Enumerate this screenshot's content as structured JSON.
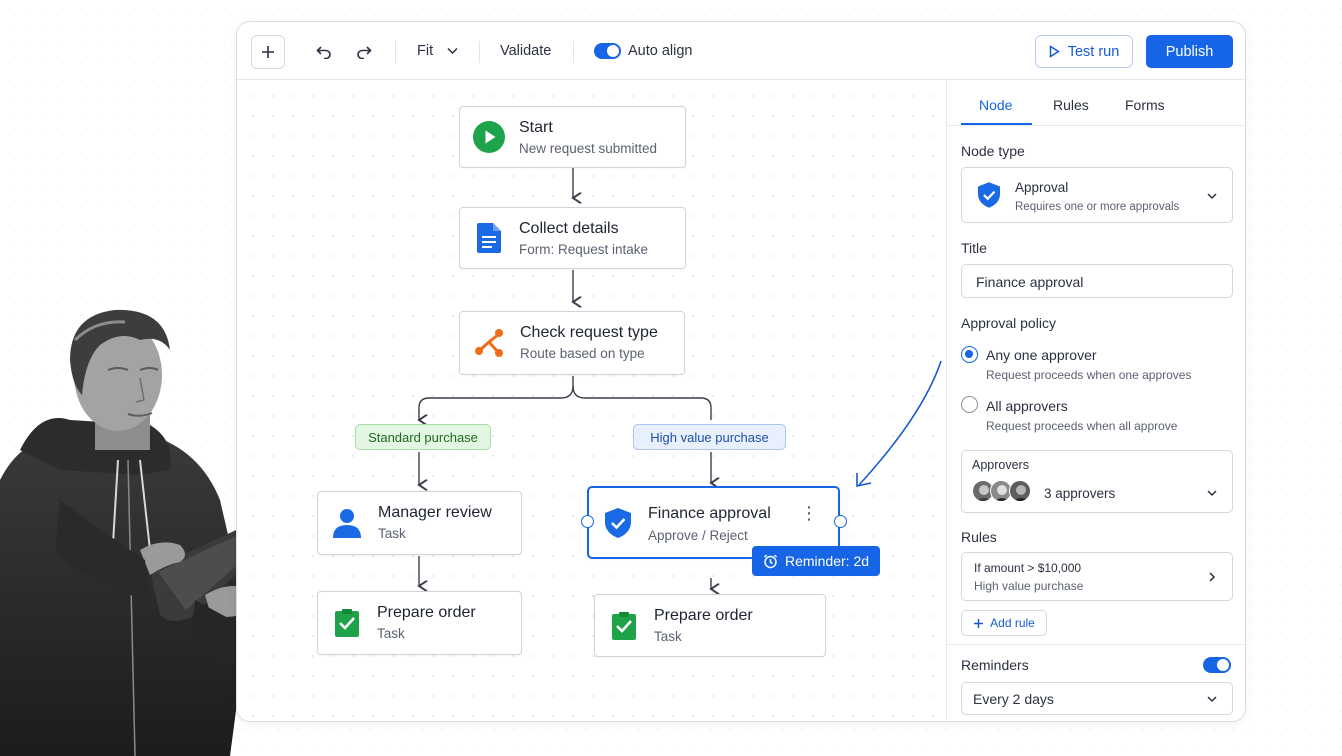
{
  "toolbar": {
    "zoom_label": "Fit",
    "validate_label": "Validate",
    "auto_align_label": "Auto align",
    "auto_align_on": true,
    "test_run_label": "Test run",
    "publish_label": "Publish"
  },
  "flow": {
    "start": {
      "title": "Start",
      "subtitle": "New request submitted",
      "icon": "play-circle-icon"
    },
    "collect": {
      "title": "Collect details",
      "subtitle": "Form: Request intake",
      "icon": "document-icon"
    },
    "check": {
      "title": "Check request type",
      "subtitle": "Route based on type",
      "icon": "branch-icon"
    },
    "branch_left": {
      "label": "Standard purchase"
    },
    "branch_right": {
      "label": "High value purchase"
    },
    "manager": {
      "title": "Manager review",
      "subtitle": "Task",
      "icon": "person-icon"
    },
    "finance": {
      "title": "Finance approval",
      "subtitle": "Approve / Reject",
      "icon": "shield-check-icon"
    },
    "reminder_badge": "Reminder: 2d",
    "prepare_left": {
      "title": "Prepare order",
      "subtitle": "Task",
      "icon": "checklist-icon"
    },
    "prepare_right": {
      "title": "Prepare order",
      "subtitle": "Task",
      "icon": "checklist-icon"
    }
  },
  "panel": {
    "tabs": [
      {
        "label": "Node",
        "active": true
      },
      {
        "label": "Rules",
        "active": false
      },
      {
        "label": "Forms",
        "active": false
      }
    ],
    "node_type_label": "Node type",
    "node_type": {
      "title": "Approval",
      "subtitle": "Requires one or more approvals"
    },
    "title_label": "Title",
    "title_value": "Finance approval",
    "policy_label": "Approval policy",
    "policy_options": [
      {
        "title": "Any one approver",
        "desc": "Request proceeds when one approves",
        "selected": true
      },
      {
        "title": "All approvers",
        "desc": "Request proceeds when all approve",
        "selected": false
      }
    ],
    "approvers_label": "Approvers",
    "approvers_count": "3 approvers",
    "rules_label": "Rules",
    "rule": {
      "condition": "If amount > $10,000",
      "name": "High value purchase"
    },
    "add_rule_label": "Add rule",
    "reminders_label": "Reminders",
    "reminders_on": true,
    "reminder_frequency": "Every 2 days"
  },
  "colors": {
    "accent": "#1565e6",
    "start_green": "#1fa34a",
    "branch_orange": "#ef6c1a",
    "tag_green_bg": "#e3f5e3",
    "tag_blue_bg": "#e8f0fd"
  }
}
